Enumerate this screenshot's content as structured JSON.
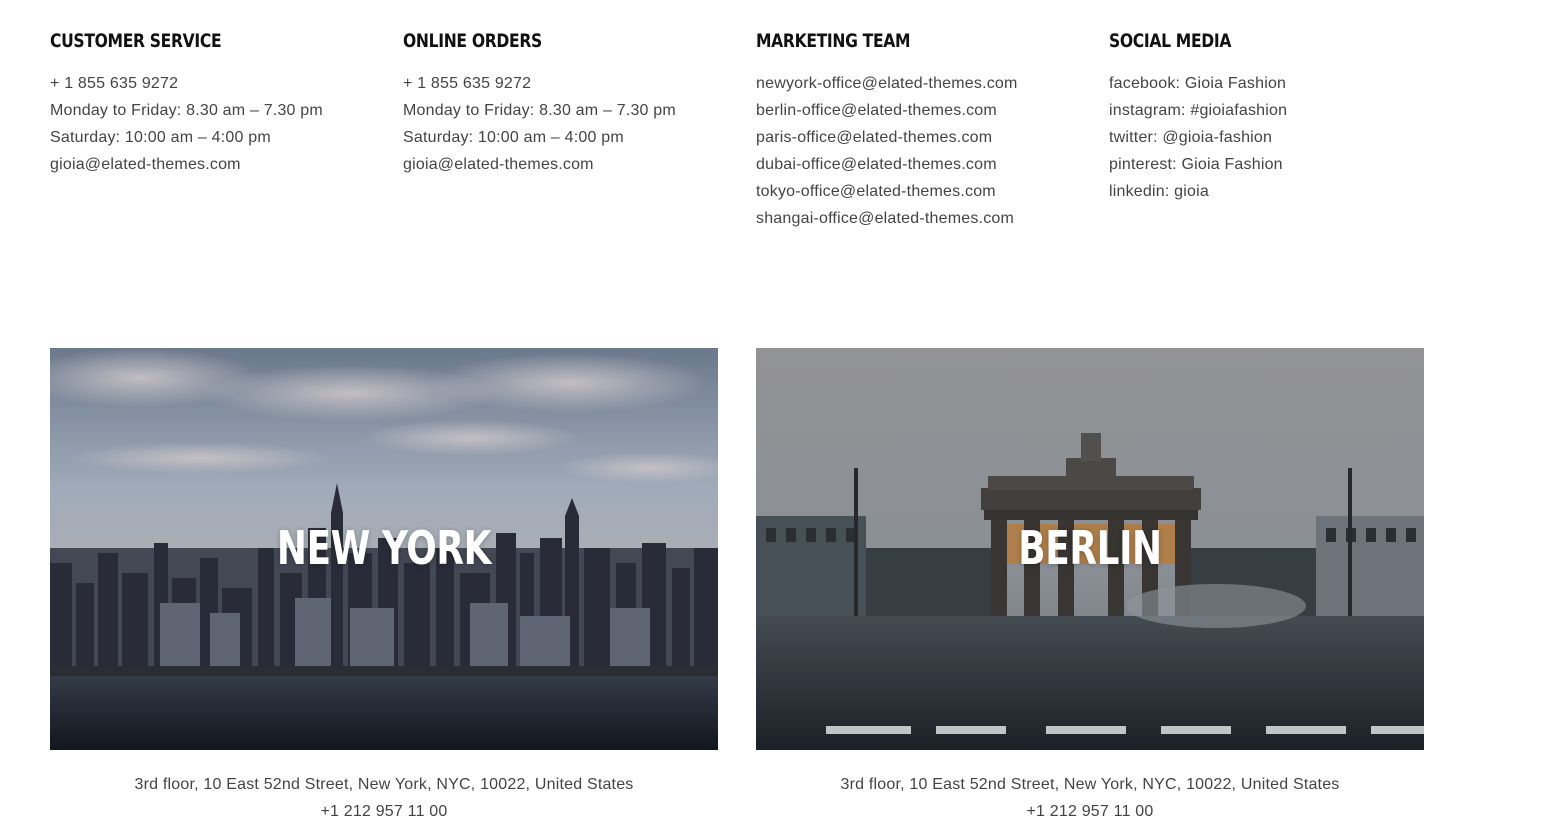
{
  "contact_columns": [
    {
      "title": "CUSTOMER SERVICE",
      "lines": [
        "+ 1 855 635 9272",
        "Monday to Friday: 8.30 am – 7.30 pm",
        "Saturday: 10:00 am – 4:00 pm",
        "gioia@elated-themes.com"
      ]
    },
    {
      "title": "ONLINE ORDERS",
      "lines": [
        "+ 1 855 635 9272",
        "Monday to Friday: 8.30 am – 7.30 pm",
        "Saturday: 10:00 am – 4:00 pm",
        "gioia@elated-themes.com"
      ]
    },
    {
      "title": "MARKETING TEAM",
      "lines": [
        "newyork-office@elated-themes.com",
        "berlin-office@elated-themes.com",
        "paris-office@elated-themes.com",
        "dubai-office@elated-themes.com",
        "tokyo-office@elated-themes.com",
        "shangai-office@elated-themes.com"
      ]
    },
    {
      "title": "SOCIAL MEDIA",
      "lines": [
        "facebook: Gioia Fashion",
        "instagram: #gioiafashion",
        "twitter: @gioia-fashion",
        "pinterest: Gioia Fashion",
        "linkedin: gioia"
      ]
    }
  ],
  "offices": [
    {
      "city": "NEW YORK",
      "address": "3rd floor, 10 East 52nd Street, New York, NYC, 10022, United States",
      "phone": "+1 212 957 11 00"
    },
    {
      "city": "BERLIN",
      "address": "3rd floor, 10 East 52nd Street, New York, NYC, 10022, United States",
      "phone": "+1 212 957 11 00"
    }
  ],
  "colors": {
    "heading": "#111111",
    "body_text": "#444444",
    "overlay_text": "#ffffff"
  }
}
